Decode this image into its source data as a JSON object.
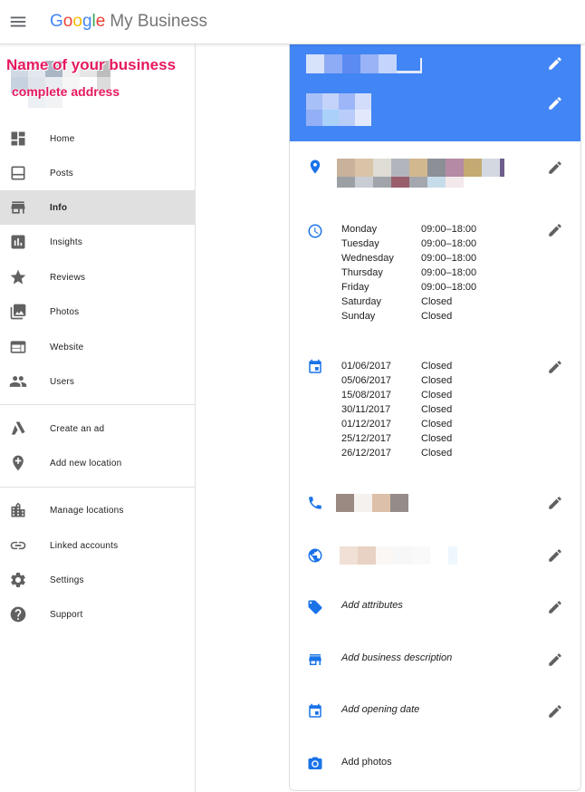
{
  "header": {
    "logo_letters": [
      "G",
      "o",
      "o",
      "g",
      "l",
      "e"
    ],
    "product": "My Business"
  },
  "annotations": {
    "business_name": "Name of your business",
    "business_address": "complete address"
  },
  "sidebar": {
    "group1": [
      {
        "label": "Home",
        "icon": "dashboard-icon"
      },
      {
        "label": "Posts",
        "icon": "posts-icon"
      },
      {
        "label": "Info",
        "icon": "storefront-icon",
        "active": true
      },
      {
        "label": "Insights",
        "icon": "bar-chart-icon"
      },
      {
        "label": "Reviews",
        "icon": "star-icon"
      },
      {
        "label": "Photos",
        "icon": "photo-library-icon"
      },
      {
        "label": "Website",
        "icon": "web-icon"
      },
      {
        "label": "Users",
        "icon": "people-icon"
      }
    ],
    "group2": [
      {
        "label": "Create an ad",
        "icon": "google-ads-icon"
      },
      {
        "label": "Add new location",
        "icon": "add-location-icon"
      }
    ],
    "group3": [
      {
        "label": "Manage locations",
        "icon": "location-grid-icon"
      },
      {
        "label": "Linked accounts",
        "icon": "link-icon"
      },
      {
        "label": "Settings",
        "icon": "gear-icon"
      },
      {
        "label": "Support",
        "icon": "help-icon"
      }
    ]
  },
  "info": {
    "hours": [
      {
        "day": "Monday",
        "time": "09:00–18:00"
      },
      {
        "day": "Tuesday",
        "time": "09:00–18:00"
      },
      {
        "day": "Wednesday",
        "time": "09:00–18:00"
      },
      {
        "day": "Thursday",
        "time": "09:00–18:00"
      },
      {
        "day": "Friday",
        "time": "09:00–18:00"
      },
      {
        "day": "Saturday",
        "time": "Closed"
      },
      {
        "day": "Sunday",
        "time": "Closed"
      }
    ],
    "special_hours": [
      {
        "date": "01/06/2017",
        "status": "Closed"
      },
      {
        "date": "05/06/2017",
        "status": "Closed"
      },
      {
        "date": "15/08/2017",
        "status": "Closed"
      },
      {
        "date": "30/11/2017",
        "status": "Closed"
      },
      {
        "date": "01/12/2017",
        "status": "Closed"
      },
      {
        "date": "25/12/2017",
        "status": "Closed"
      },
      {
        "date": "26/12/2017",
        "status": "Closed"
      }
    ],
    "add_attributes": "Add attributes",
    "add_description": "Add business description",
    "add_opening_date": "Add opening date",
    "add_photos": "Add photos"
  },
  "colors": {
    "accent": "#4285f4",
    "annotation": "#e5195f",
    "icon_grey": "#616161",
    "active_bg": "#e0e0e0"
  }
}
